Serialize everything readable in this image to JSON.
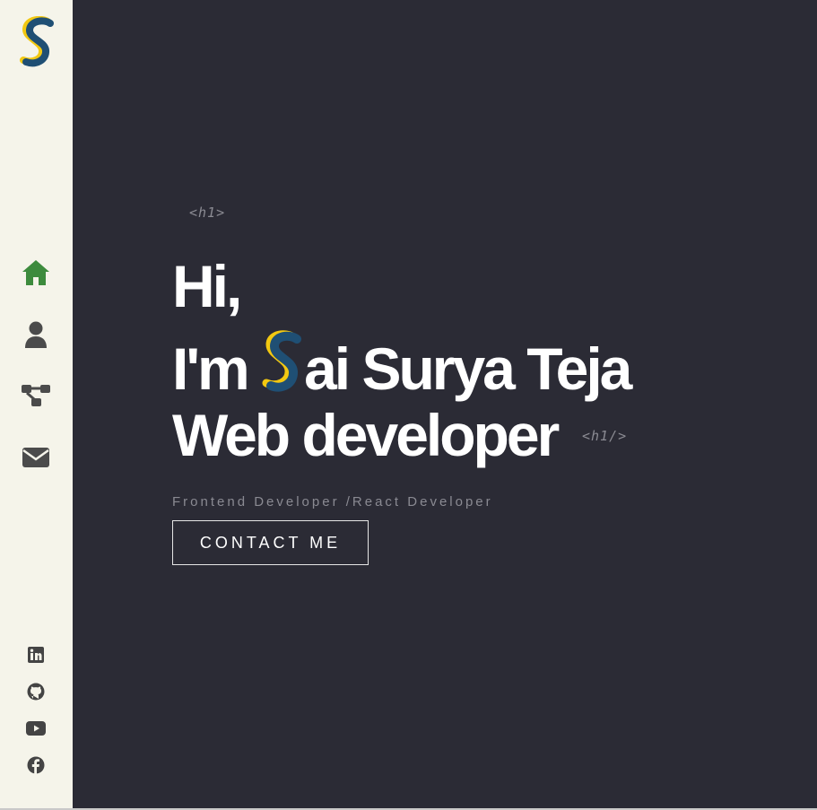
{
  "sidebar": {
    "logo_icon": "s-logo-icon",
    "nav": [
      {
        "name": "home",
        "icon": "home-icon",
        "color": "#3d8b3d"
      },
      {
        "name": "about",
        "icon": "user-icon",
        "color": "#4b4b4b"
      },
      {
        "name": "skills",
        "icon": "sitemap-icon",
        "color": "#4b4b4b"
      },
      {
        "name": "contact",
        "icon": "envelope-icon",
        "color": "#4b4b4b"
      }
    ],
    "social": [
      {
        "name": "linkedin",
        "icon": "linkedin-icon"
      },
      {
        "name": "github",
        "icon": "github-icon"
      },
      {
        "name": "youtube",
        "icon": "youtube-icon"
      },
      {
        "name": "facebook",
        "icon": "facebook-icon"
      }
    ]
  },
  "hero": {
    "open_tag": "<h1>",
    "line1": "Hi,",
    "line2_prefix": "I'm",
    "line2_rest": "ai Surya Teja",
    "line3": "Web developer",
    "close_tag": "<h1/>",
    "subtitle": "Frontend Developer /React Developer",
    "contact_label": "CONTACT ME"
  },
  "colors": {
    "sidebar_bg": "#f5f4ea",
    "main_bg": "#2b2b35",
    "logo_blue": "#1f4f74",
    "logo_yellow": "#f2c811",
    "active_nav": "#3d8b3d"
  }
}
